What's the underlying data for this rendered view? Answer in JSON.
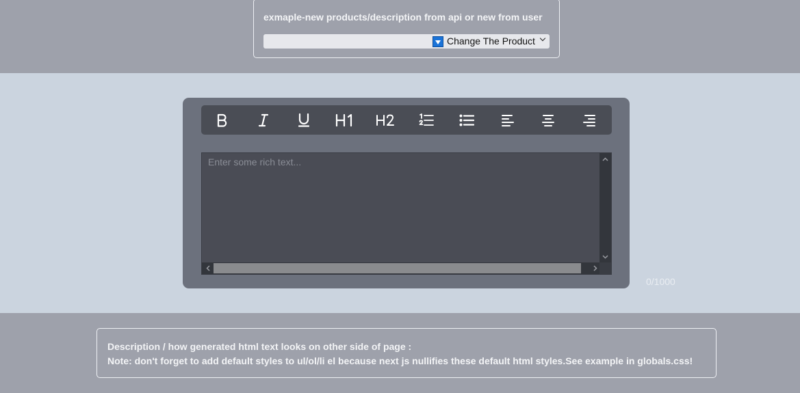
{
  "header": {
    "title": "exmaple-new products/description from api or new from user",
    "product_select": {
      "selected": "Change The Product"
    }
  },
  "editor": {
    "toolbar": [
      {
        "name": "bold",
        "icon": "bold-icon",
        "label": "B"
      },
      {
        "name": "italic",
        "icon": "italic-icon",
        "label": "I"
      },
      {
        "name": "underline",
        "icon": "underline-icon",
        "label": "U"
      },
      {
        "name": "heading-1",
        "icon": "heading-1-icon",
        "label": "H1"
      },
      {
        "name": "heading-2",
        "icon": "heading-2-icon",
        "label": "H2"
      },
      {
        "name": "ordered-list",
        "icon": "ordered-list-icon"
      },
      {
        "name": "bulleted-list",
        "icon": "bulleted-list-icon"
      },
      {
        "name": "align-left",
        "icon": "align-left-icon"
      },
      {
        "name": "align-center",
        "icon": "align-center-icon"
      },
      {
        "name": "align-right",
        "icon": "align-right-icon"
      }
    ],
    "placeholder": "Enter some rich text...",
    "char_count": "0/1000"
  },
  "description": {
    "line1": "Description / how generated html text looks on other side of page :",
    "line2": "Note: don't forget to add default styles to ul/ol/li el because next js nullifies these default html styles.See example in globals.css!"
  },
  "colors": {
    "page_band": "#9ea1ab",
    "editor_band": "#cbd4df",
    "editor_card": "#6c717d",
    "toolbar": "#4a4d55",
    "select_icon": "#1a73d8"
  }
}
